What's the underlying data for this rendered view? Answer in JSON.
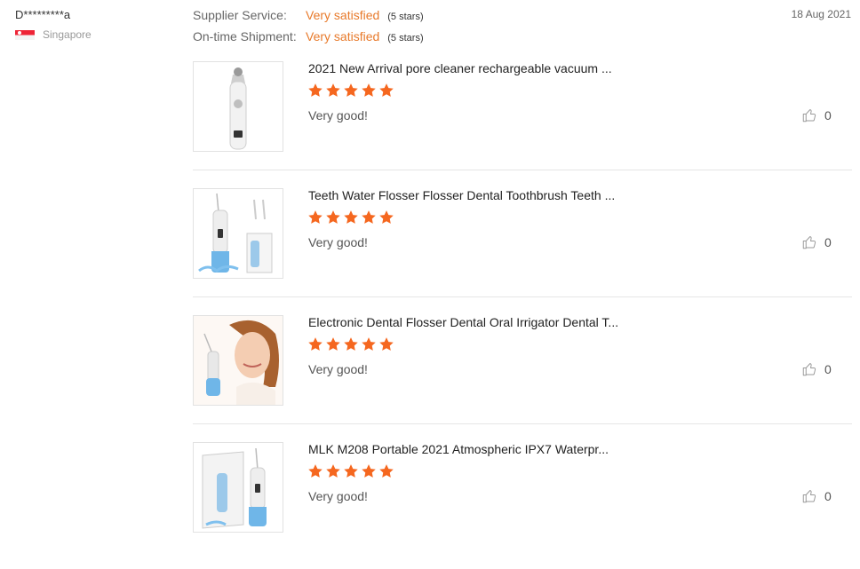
{
  "buyer": {
    "name": "D*********a",
    "country": "Singapore"
  },
  "date": "18 Aug 2021",
  "ratings": [
    {
      "label": "Supplier Service:",
      "value": "Very satisfied",
      "stars": "(5 stars)"
    },
    {
      "label": "On-time Shipment:",
      "value": "Very satisfied",
      "stars": "(5 stars)"
    }
  ],
  "colors": {
    "accent": "#e87a2b",
    "star": "#f5671f",
    "divider": "#e5e5e5"
  },
  "reviews": [
    {
      "title": "2021 New Arrival pore cleaner rechargeable vacuum ...",
      "rating": 5,
      "comment": "Very good!",
      "helpful": "0",
      "image": "pore-vacuum-product-image"
    },
    {
      "title": "Teeth Water Flosser Flosser Dental Toothbrush Teeth ...",
      "rating": 5,
      "comment": "Very good!",
      "helpful": "0",
      "image": "water-flosser-product-image"
    },
    {
      "title": "Electronic Dental Flosser Dental Oral Irrigator Dental T...",
      "rating": 5,
      "comment": "Very good!",
      "helpful": "0",
      "image": "woman-with-flosser-image"
    },
    {
      "title": "MLK M208 Portable 2021 Atmospheric IPX7 Waterpr...",
      "rating": 5,
      "comment": "Very good!",
      "helpful": "0",
      "image": "flosser-with-box-image"
    }
  ]
}
